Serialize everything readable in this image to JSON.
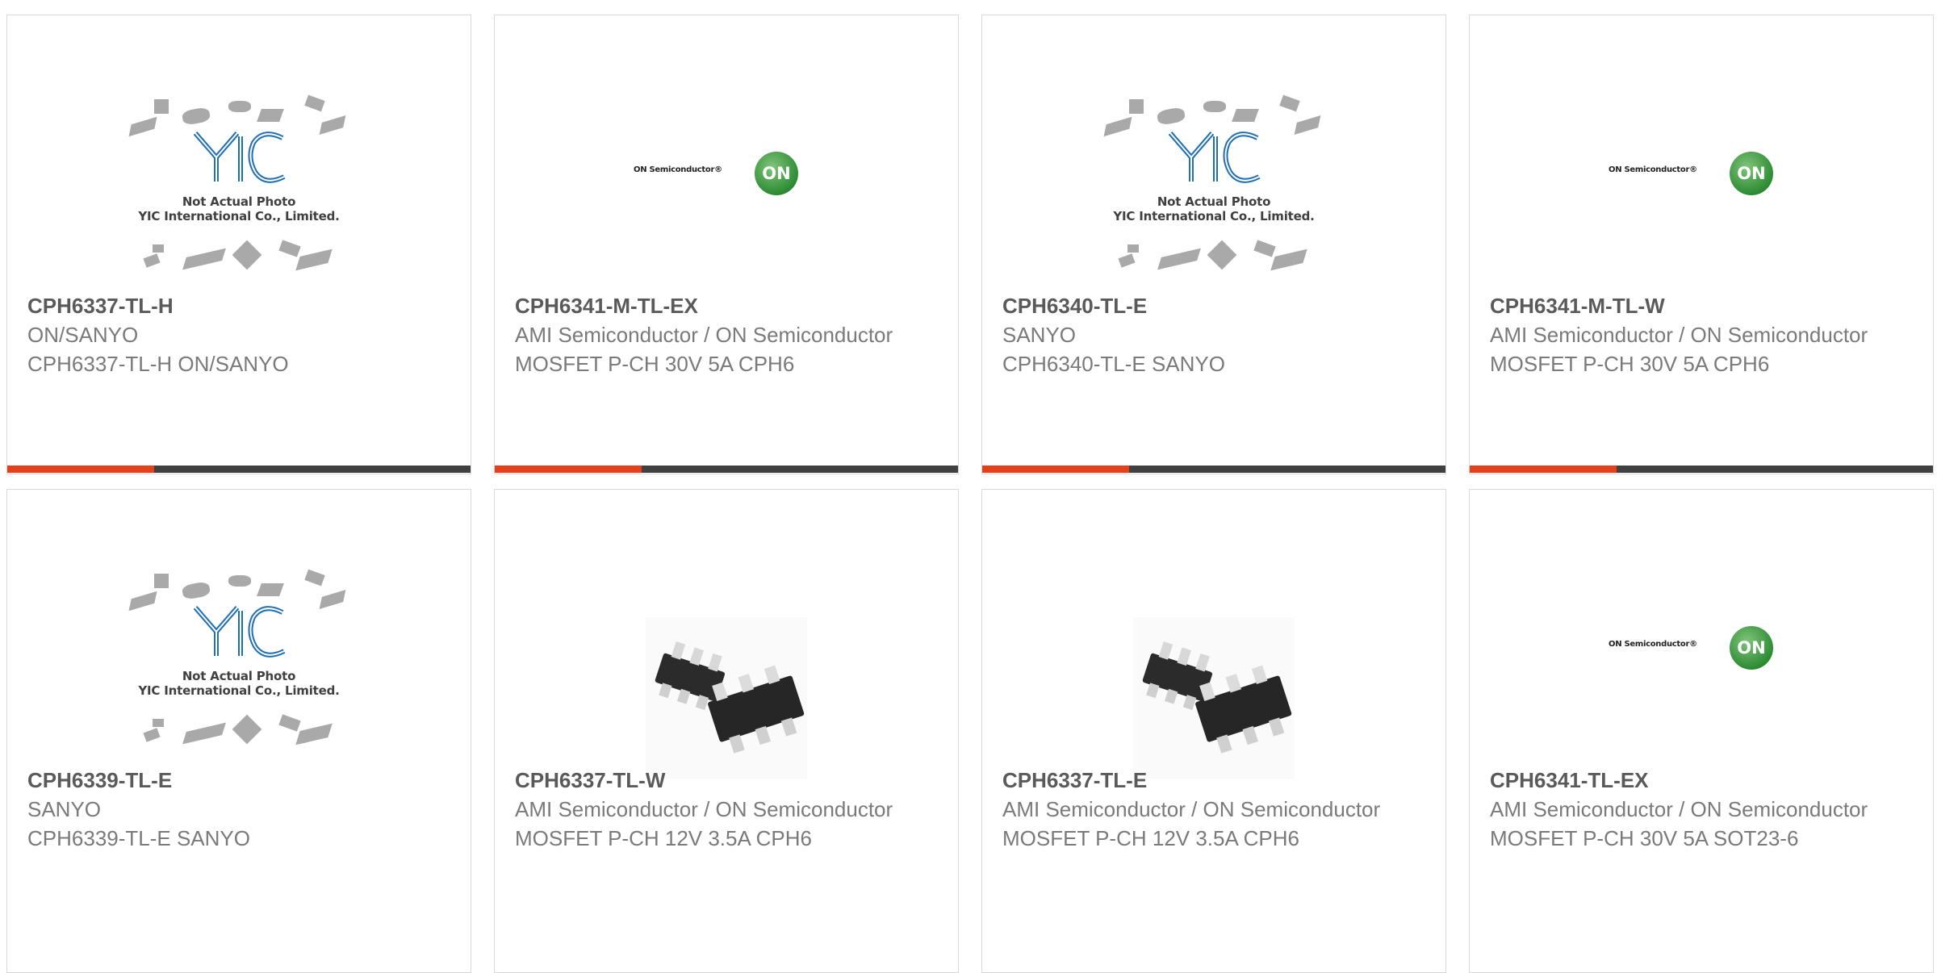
{
  "products": [
    {
      "pn": "CPH6337-TL-H",
      "mfr": "ON/SANYO",
      "desc": "CPH6337-TL-H ON/SANYO",
      "image": "yic-placeholder"
    },
    {
      "pn": "CPH6341-M-TL-EX",
      "mfr": "AMI Semiconductor / ON Semiconductor",
      "desc": "MOSFET P-CH 30V 5A CPH6",
      "image": "on-semiconductor-logo"
    },
    {
      "pn": "CPH6340-TL-E",
      "mfr": "SANYO",
      "desc": "CPH6340-TL-E SANYO",
      "image": "yic-placeholder"
    },
    {
      "pn": "CPH6341-M-TL-W",
      "mfr": "AMI Semiconductor / ON Semiconductor",
      "desc": "MOSFET P-CH 30V 5A CPH6",
      "image": "on-semiconductor-logo"
    },
    {
      "pn": "CPH6339-TL-E",
      "mfr": "SANYO",
      "desc": "CPH6339-TL-E SANYO",
      "image": "yic-placeholder"
    },
    {
      "pn": "CPH6337-TL-W",
      "mfr": "AMI Semiconductor / ON Semiconductor",
      "desc": "MOSFET P-CH 12V 3.5A CPH6",
      "image": "cph6-package-photo"
    },
    {
      "pn": "CPH6337-TL-E",
      "mfr": "AMI Semiconductor / ON Semiconductor",
      "desc": "MOSFET P-CH 12V 3.5A CPH6",
      "image": "cph6-package-photo"
    },
    {
      "pn": "CPH6341-TL-EX",
      "mfr": "AMI Semiconductor / ON Semiconductor",
      "desc": "MOSFET P-CH 30V 5A SOT23-6",
      "image": "on-semiconductor-logo"
    }
  ],
  "placeholder": {
    "line1": "Not Actual Photo",
    "line2": "YIC International Co., Limited."
  },
  "on_logo": {
    "text": "ON Semiconductor®",
    "badge": "ON"
  },
  "colors": {
    "accent": "#e5401a",
    "bar": "#404040",
    "badge_green": "#2e8c34",
    "yic_blue": "#1f6fb5"
  }
}
